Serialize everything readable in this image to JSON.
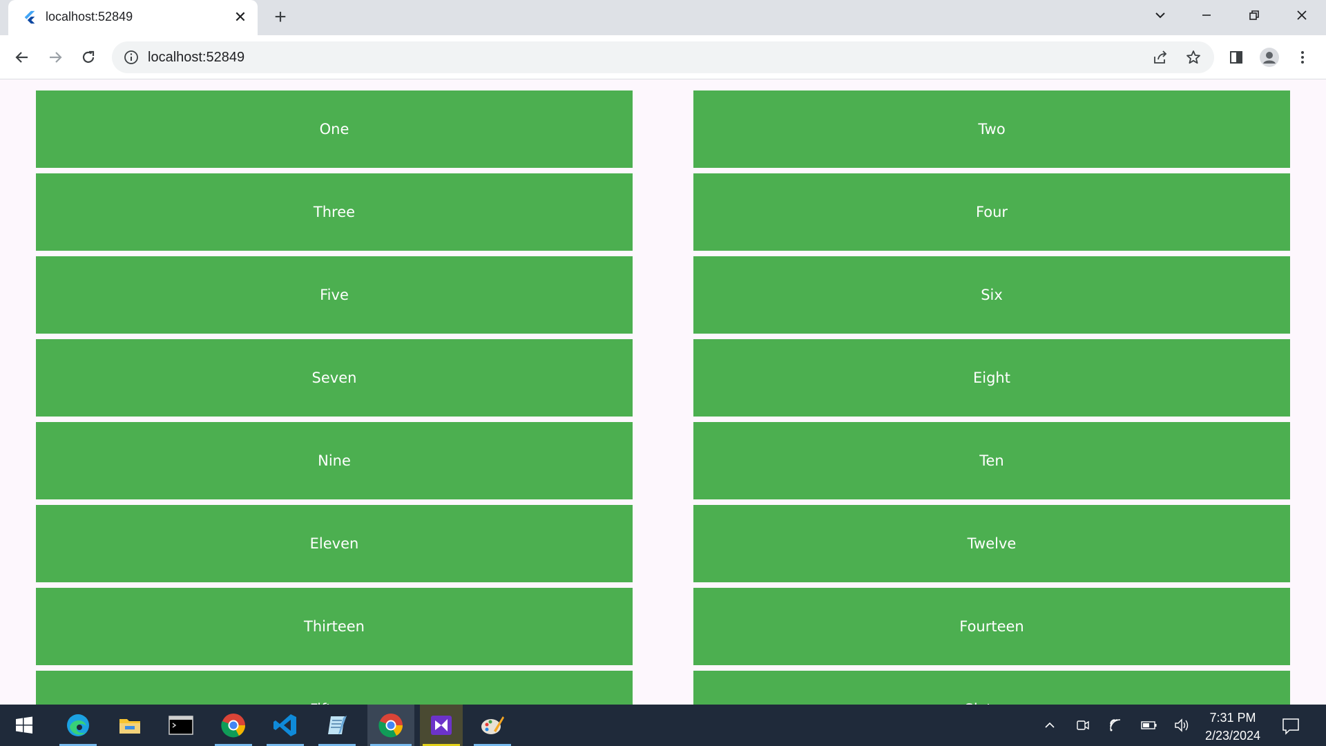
{
  "browser": {
    "tab_title": "localhost:52849",
    "tab_close": "✕",
    "new_tab": "+",
    "url": "localhost:52849"
  },
  "tiles": [
    "One",
    "Two",
    "Three",
    "Four",
    "Five",
    "Six",
    "Seven",
    "Eight",
    "Nine",
    "Ten",
    "Eleven",
    "Twelve",
    "Thirteen",
    "Fourteen",
    "Fifteen",
    "Sixteen"
  ],
  "colors": {
    "tile": "#4caf50",
    "tile_text": "#ffffff",
    "page_bg": "#fdf7fd"
  },
  "taskbar": {
    "time": "7:31 PM",
    "date": "2/23/2024",
    "apps": [
      "start-icon",
      "edge-icon",
      "file-explorer-icon",
      "terminal-icon",
      "chrome-icon",
      "vscode-icon",
      "notepad-icon",
      "chrome-icon",
      "visual-studio-icon",
      "paint-icon"
    ]
  }
}
